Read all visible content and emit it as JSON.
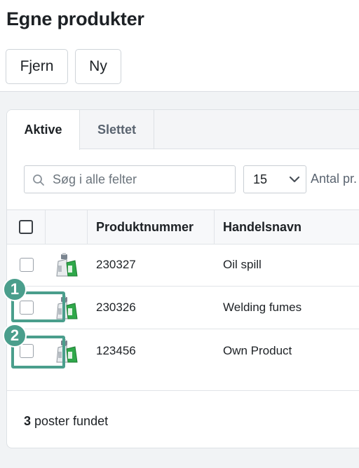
{
  "header": {
    "title": "Egne produkter",
    "remove_label": "Fjern",
    "new_label": "Ny"
  },
  "tabs": [
    {
      "label": "Aktive",
      "active": true
    },
    {
      "label": "Slettet",
      "active": false
    }
  ],
  "toolbar": {
    "search_placeholder": "Søg i alle felter",
    "page_size": "15",
    "per_page_label": "Antal pr. side"
  },
  "table": {
    "columns": [
      "Produktnummer",
      "Handelsnavn"
    ],
    "rows": [
      {
        "number": "230327",
        "name": "Oil spill",
        "checked": false
      },
      {
        "number": "230326",
        "name": "Welding fumes",
        "checked": false
      },
      {
        "number": "123456",
        "name": "Own Product",
        "checked": false
      }
    ]
  },
  "footer": {
    "count": "3",
    "count_suffix": " poster fundet"
  },
  "callouts": [
    "1",
    "2"
  ],
  "colors": {
    "accent": "#4a9e8c",
    "border": "#dde1e5",
    "background": "#f1f3f5"
  }
}
